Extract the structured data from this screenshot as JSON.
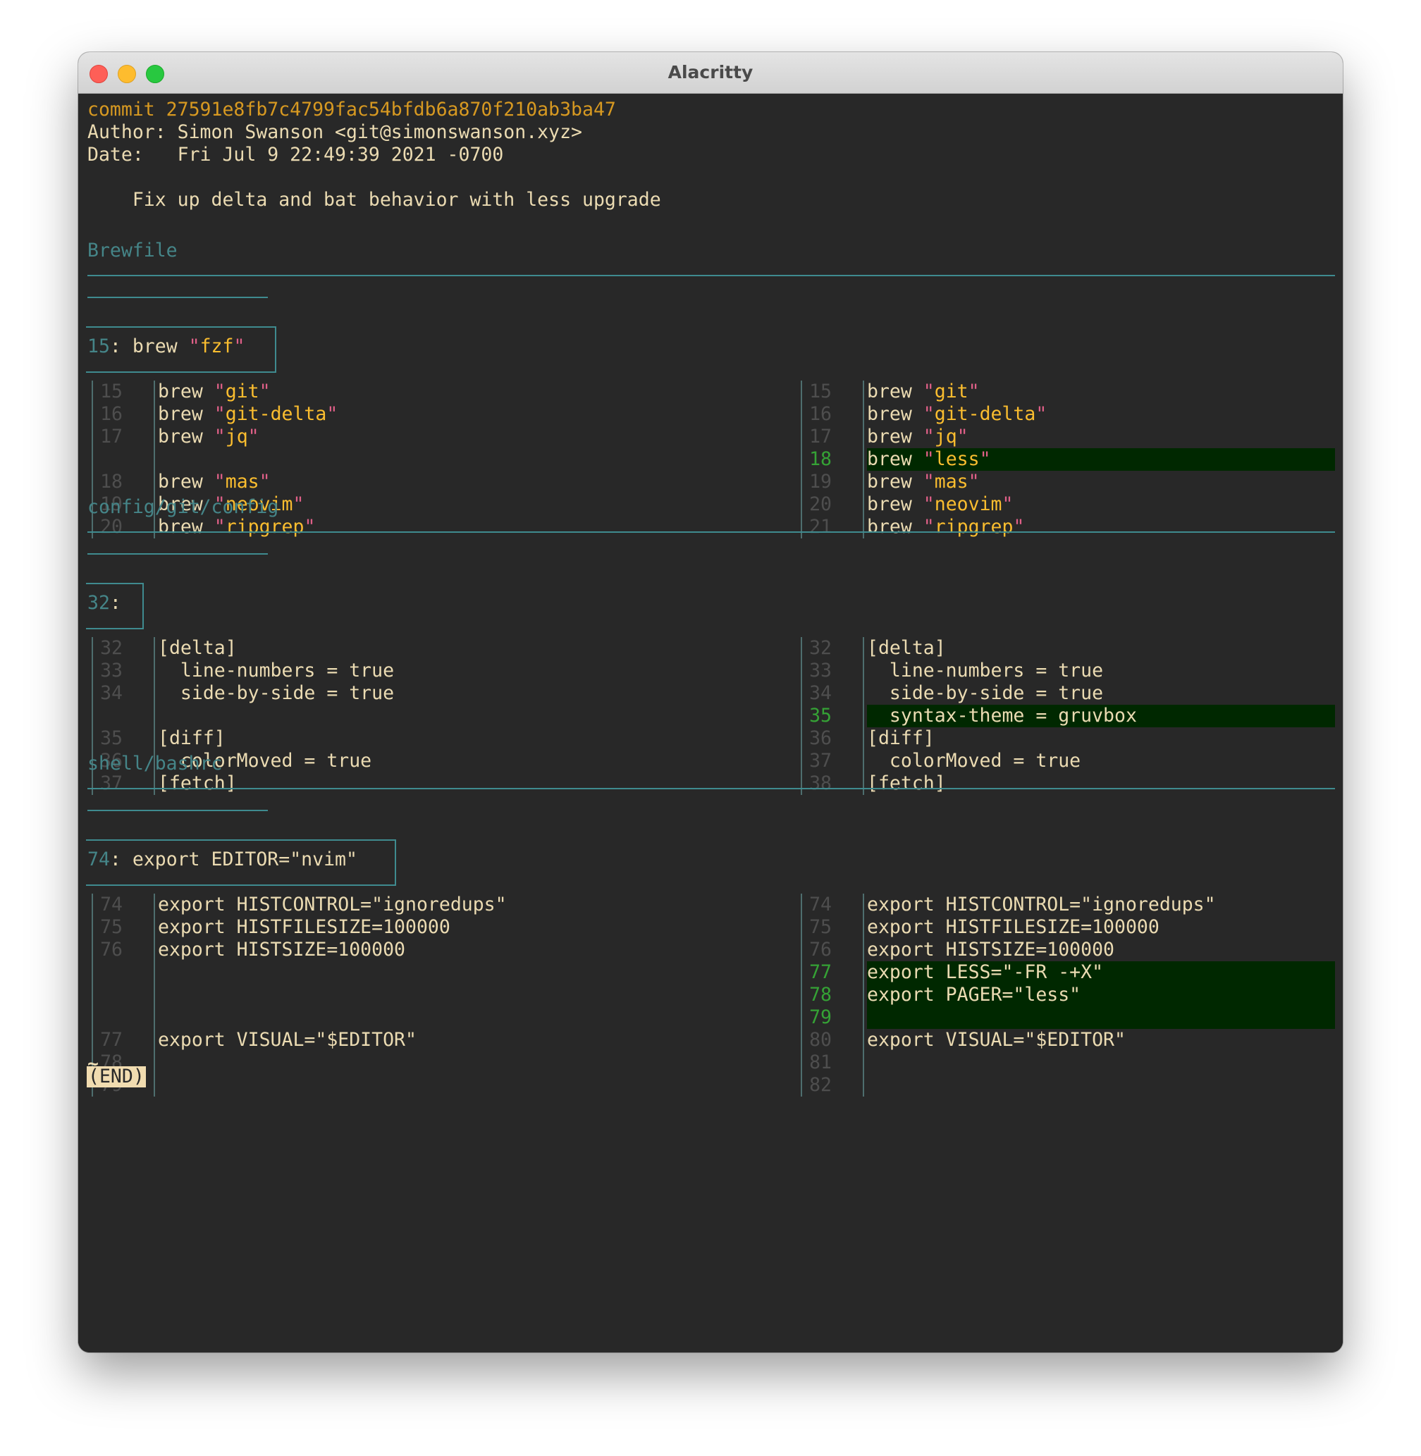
{
  "window": {
    "title": "Alacritty"
  },
  "commit": {
    "line": "commit 27591e8fb7c4799fac54bfdb6a870f210ab3ba47",
    "author": "Author: Simon Swanson <git@simonswanson.xyz>",
    "date": "Date:   Fri Jul 9 22:49:39 2021 -0700",
    "message": "    Fix up delta and bat behavior with less upgrade"
  },
  "files": [
    {
      "name": "Brewfile",
      "hunk_num": "15",
      "hunk_sep": ": ",
      "hunk_code": "brew ",
      "hunk_str": "fzf",
      "left": [
        {
          "n": "15",
          "kw": "brew ",
          "s": "git"
        },
        {
          "n": "16",
          "kw": "brew ",
          "s": "git-delta"
        },
        {
          "n": "17",
          "kw": "brew ",
          "s": "jq"
        },
        {
          "n": "",
          "kw": "",
          "s": ""
        },
        {
          "n": "18",
          "kw": "brew ",
          "s": "mas"
        },
        {
          "n": "19",
          "kw": "brew ",
          "s": "neovim"
        },
        {
          "n": "20",
          "kw": "brew ",
          "s": "ripgrep"
        }
      ],
      "right": [
        {
          "n": "15",
          "kw": "brew ",
          "s": "git"
        },
        {
          "n": "16",
          "kw": "brew ",
          "s": "git-delta"
        },
        {
          "n": "17",
          "kw": "brew ",
          "s": "jq"
        },
        {
          "n": "18",
          "kw": "brew ",
          "s": "less",
          "added": true
        },
        {
          "n": "19",
          "kw": "brew ",
          "s": "mas"
        },
        {
          "n": "20",
          "kw": "brew ",
          "s": "neovim"
        },
        {
          "n": "21",
          "kw": "brew ",
          "s": "ripgrep"
        }
      ]
    },
    {
      "name": "config/git/config",
      "hunk_num": "32",
      "hunk_sep": ":",
      "hunk_code": "",
      "hunk_str": "",
      "left": [
        {
          "n": "32",
          "t": "[delta]"
        },
        {
          "n": "33",
          "t": "  line-numbers = true"
        },
        {
          "n": "34",
          "t": "  side-by-side = true"
        },
        {
          "n": "",
          "t": ""
        },
        {
          "n": "35",
          "t": "[diff]"
        },
        {
          "n": "36",
          "t": "  colorMoved = true"
        },
        {
          "n": "37",
          "t": "[fetch]"
        }
      ],
      "right": [
        {
          "n": "32",
          "t": "[delta]"
        },
        {
          "n": "33",
          "t": "  line-numbers = true"
        },
        {
          "n": "34",
          "t": "  side-by-side = true"
        },
        {
          "n": "35",
          "t": "  syntax-theme = gruvbox",
          "added": true
        },
        {
          "n": "36",
          "t": "[diff]"
        },
        {
          "n": "37",
          "t": "  colorMoved = true"
        },
        {
          "n": "38",
          "t": "[fetch]"
        }
      ]
    },
    {
      "name": "shell/bashrc",
      "hunk_num": "74",
      "hunk_sep": ": ",
      "hunk_code": "export EDITOR=\"nvim\"",
      "hunk_str": "",
      "left": [
        {
          "n": "74",
          "t": "export HISTCONTROL=\"ignoredups\""
        },
        {
          "n": "75",
          "t": "export HISTFILESIZE=100000"
        },
        {
          "n": "76",
          "t": "export HISTSIZE=100000"
        },
        {
          "n": "",
          "t": ""
        },
        {
          "n": "",
          "t": ""
        },
        {
          "n": "",
          "t": ""
        },
        {
          "n": "77",
          "t": "export VISUAL=\"$EDITOR\""
        },
        {
          "n": "78",
          "t": ""
        },
        {
          "n": "79",
          "t": ""
        }
      ],
      "right": [
        {
          "n": "74",
          "t": "export HISTCONTROL=\"ignoredups\""
        },
        {
          "n": "75",
          "t": "export HISTFILESIZE=100000"
        },
        {
          "n": "76",
          "t": "export HISTSIZE=100000"
        },
        {
          "n": "77",
          "t": "export LESS=\"-FR -+X\"",
          "added": true
        },
        {
          "n": "78",
          "t": "export PAGER=\"less\"",
          "added": true
        },
        {
          "n": "79",
          "t": "",
          "added": true
        },
        {
          "n": "80",
          "t": "export VISUAL=\"$EDITOR\""
        },
        {
          "n": "81",
          "t": ""
        },
        {
          "n": "82",
          "t": ""
        }
      ]
    }
  ],
  "pager": {
    "tilde": "~",
    "end": "(END)"
  },
  "colors": {
    "background": "#282828",
    "foreground": "#ebdbb2",
    "commit": "#d79921",
    "filename": "#458588",
    "added_bg": "#002800",
    "added_num": "#35a235",
    "string": "#fabd2f",
    "quote": "#e06088"
  }
}
